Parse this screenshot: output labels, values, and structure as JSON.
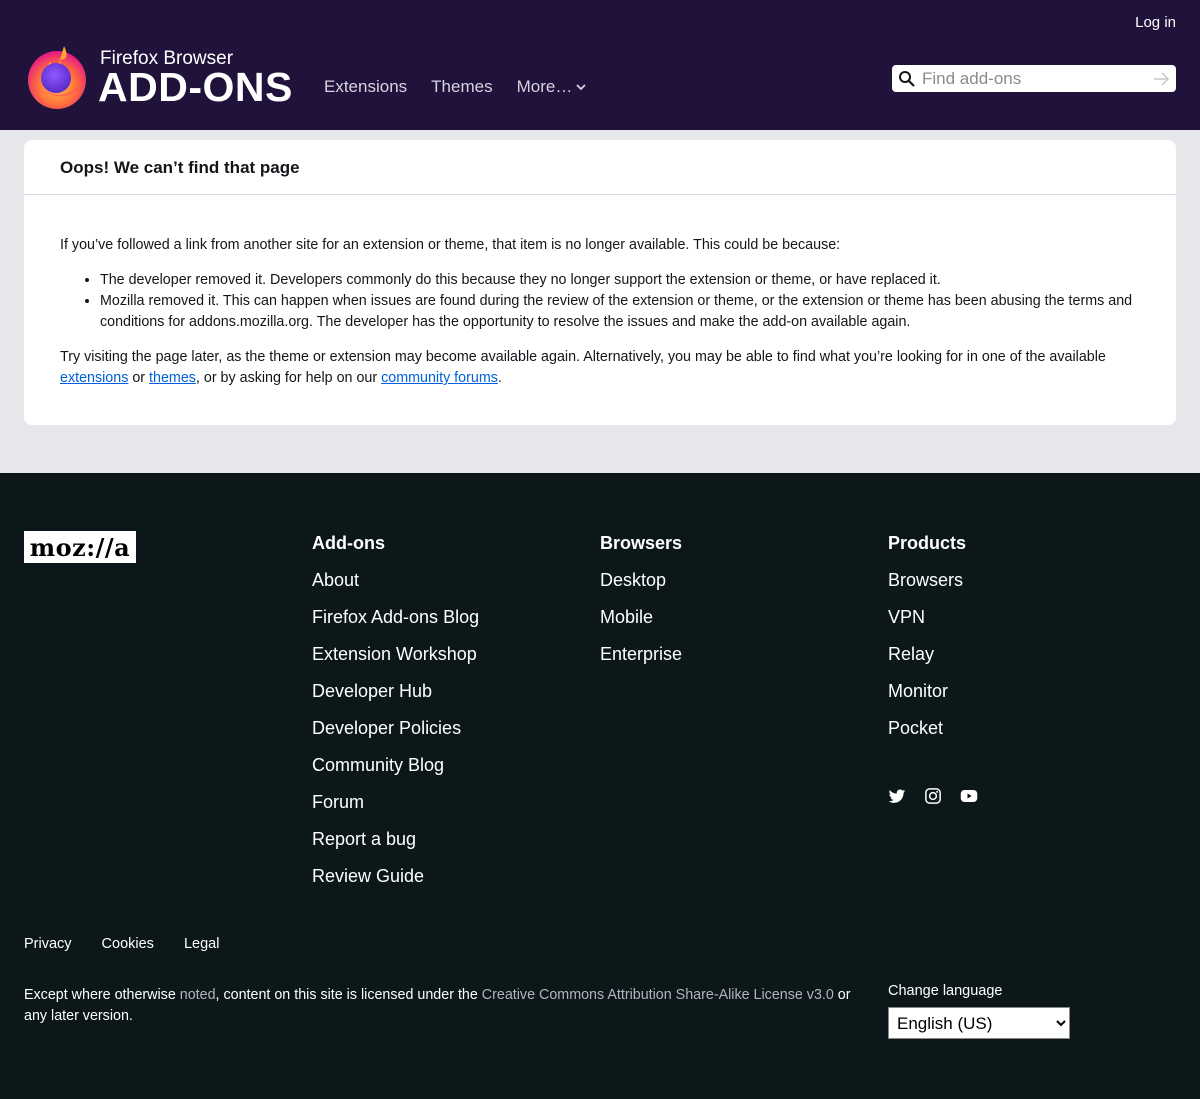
{
  "header": {
    "login_label": "Log in",
    "brand_small": "Firefox Browser",
    "brand_big": "ADD-ONS",
    "nav": [
      {
        "label": "Extensions"
      },
      {
        "label": "Themes"
      },
      {
        "label": "More…"
      }
    ],
    "search_placeholder": "Find add-ons"
  },
  "main": {
    "title": "Oops! We can’t find that page",
    "intro": "If you’ve followed a link from another site for an extension or theme, that item is no longer available. This could be because:",
    "reasons": [
      "The developer removed it. Developers commonly do this because they no longer support the extension or theme, or have replaced it.",
      "Mozilla removed it. This can happen when issues are found during the review of the extension or theme, or the extension or theme has been abusing the terms and conditions for addons.mozilla.org. The developer has the opportunity to resolve the issues and make the add-on available again."
    ],
    "suggest_text_1": "Try visiting the page later, as the theme or extension may become available again. Alternatively, you may be able to find what you’re looking for in one of the available ",
    "link_extensions": "extensions",
    "suggest_or": " or ",
    "link_themes": "themes",
    "suggest_text_2": ", or by asking for help on our ",
    "link_forums": "community forums",
    "suggest_end": "."
  },
  "footer": {
    "logo_text": "moz://a",
    "addons": {
      "heading": "Add-ons",
      "links": [
        "About",
        "Firefox Add-ons Blog",
        "Extension Workshop",
        "Developer Hub",
        "Developer Policies",
        "Community Blog",
        "Forum",
        "Report a bug",
        "Review Guide"
      ]
    },
    "browsers": {
      "heading": "Browsers",
      "links": [
        "Desktop",
        "Mobile",
        "Enterprise"
      ]
    },
    "products": {
      "heading": "Products",
      "links": [
        "Browsers",
        "VPN",
        "Relay",
        "Monitor",
        "Pocket"
      ]
    },
    "social_icons": [
      "twitter-icon",
      "instagram-icon",
      "youtube-icon"
    ],
    "legal_links": [
      "Privacy",
      "Cookies",
      "Legal"
    ],
    "license_1": "Except where otherwise ",
    "license_noted": "noted",
    "license_2": ", content on this site is licensed under the ",
    "license_cc": "Creative Commons Attribution Share-Alike License v3.0",
    "license_3": " or any later version.",
    "change_language_label": "Change language",
    "language_selected": "English (US)"
  },
  "colors": {
    "header_bg": "#20123a",
    "footer_bg": "#0b1719",
    "main_bg": "#e8e8ec",
    "link": "#0060df"
  }
}
